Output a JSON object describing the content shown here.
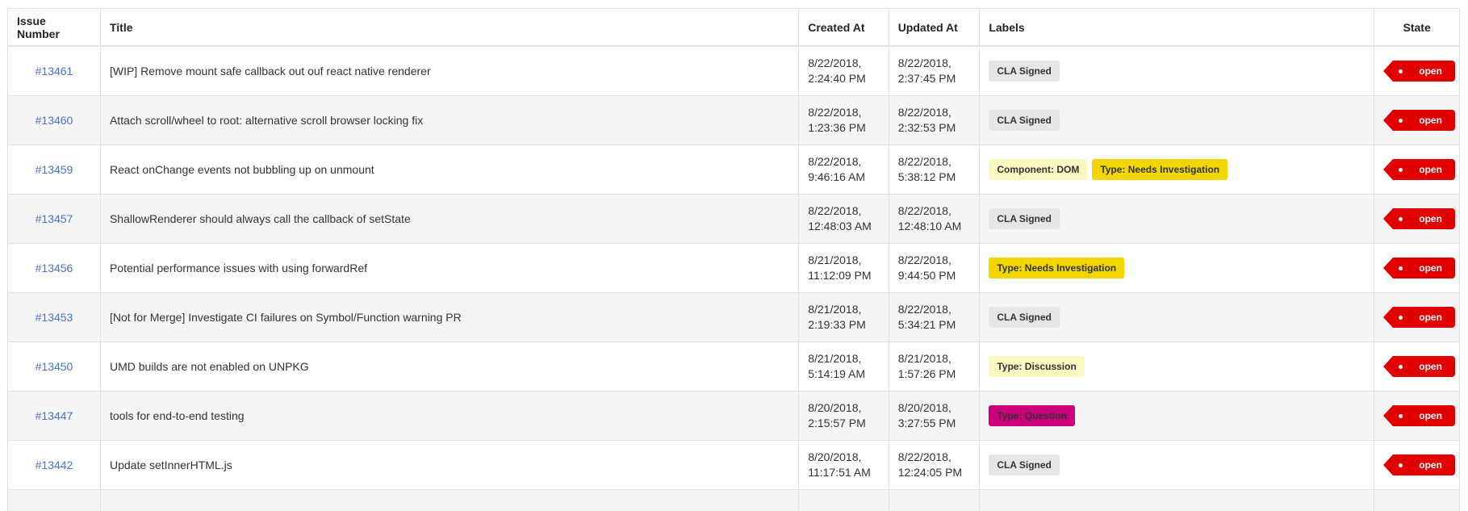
{
  "table": {
    "headers": [
      "Issue Number",
      "Title",
      "Created At",
      "Updated At",
      "Labels",
      "State"
    ],
    "rows": [
      {
        "number": "#13461",
        "title": "[WIP] Remove mount safe callback out ouf react native renderer",
        "created": [
          "8/22/2018,",
          "2:24:40 PM"
        ],
        "updated": [
          "8/22/2018,",
          "2:37:45 PM"
        ],
        "labels": [
          {
            "text": "CLA Signed",
            "bg": "#e6e6e6",
            "fg": "#333333"
          }
        ],
        "state": "open"
      },
      {
        "number": "#13460",
        "title": "Attach scroll/wheel to root: alternative scroll browser locking fix",
        "created": [
          "8/22/2018,",
          "1:23:36 PM"
        ],
        "updated": [
          "8/22/2018,",
          "2:32:53 PM"
        ],
        "labels": [
          {
            "text": "CLA Signed",
            "bg": "#e6e6e6",
            "fg": "#333333"
          }
        ],
        "state": "open"
      },
      {
        "number": "#13459",
        "title": "React onChange events not bubbling up on unmount",
        "created": [
          "8/22/2018,",
          "9:46:16 AM"
        ],
        "updated": [
          "8/22/2018,",
          "5:38:12 PM"
        ],
        "labels": [
          {
            "text": "Component: DOM",
            "bg": "#fbf8c2",
            "fg": "#333333"
          },
          {
            "text": "Type: Needs Investigation",
            "bg": "#f2d600",
            "fg": "#333333"
          }
        ],
        "state": "open"
      },
      {
        "number": "#13457",
        "title": "ShallowRenderer should always call the callback of setState",
        "created": [
          "8/22/2018,",
          "12:48:03 AM"
        ],
        "updated": [
          "8/22/2018,",
          "12:48:10 AM"
        ],
        "labels": [
          {
            "text": "CLA Signed",
            "bg": "#e6e6e6",
            "fg": "#333333"
          }
        ],
        "state": "open"
      },
      {
        "number": "#13456",
        "title": "Potential performance issues with using forwardRef",
        "created": [
          "8/21/2018,",
          "11:12:09 PM"
        ],
        "updated": [
          "8/22/2018,",
          "9:44:50 PM"
        ],
        "labels": [
          {
            "text": "Type: Needs Investigation",
            "bg": "#f2d600",
            "fg": "#333333"
          }
        ],
        "state": "open"
      },
      {
        "number": "#13453",
        "title": "[Not for Merge] Investigate CI failures on Symbol/Function warning PR",
        "created": [
          "8/21/2018,",
          "2:19:33 PM"
        ],
        "updated": [
          "8/22/2018,",
          "5:34:21 PM"
        ],
        "labels": [
          {
            "text": "CLA Signed",
            "bg": "#e6e6e6",
            "fg": "#333333"
          }
        ],
        "state": "open"
      },
      {
        "number": "#13450",
        "title": "UMD builds are not enabled on UNPKG",
        "created": [
          "8/21/2018,",
          "5:14:19 AM"
        ],
        "updated": [
          "8/21/2018,",
          "1:57:26 PM"
        ],
        "labels": [
          {
            "text": "Type: Discussion",
            "bg": "#fbf8c2",
            "fg": "#333333"
          }
        ],
        "state": "open"
      },
      {
        "number": "#13447",
        "title": "tools for end-to-end testing",
        "created": [
          "8/20/2018,",
          "2:15:57 PM"
        ],
        "updated": [
          "8/20/2018,",
          "3:27:55 PM"
        ],
        "labels": [
          {
            "text": "Type: Question",
            "bg": "#cc007a",
            "fg": "#333333"
          }
        ],
        "state": "open"
      },
      {
        "number": "#13442",
        "title": "Update setInnerHTML.js",
        "created": [
          "8/20/2018,",
          "11:17:51 AM"
        ],
        "updated": [
          "8/22/2018,",
          "12:24:05 PM"
        ],
        "labels": [
          {
            "text": "CLA Signed",
            "bg": "#e6e6e6",
            "fg": "#333333"
          }
        ],
        "state": "open"
      }
    ]
  },
  "colors": {
    "link": "#4a72c8",
    "state_open": "#e00000",
    "border": "#dee2e6",
    "stripe": "#f5f5f5"
  },
  "icons": {
    "state_tag": "tag-dot-icon"
  }
}
